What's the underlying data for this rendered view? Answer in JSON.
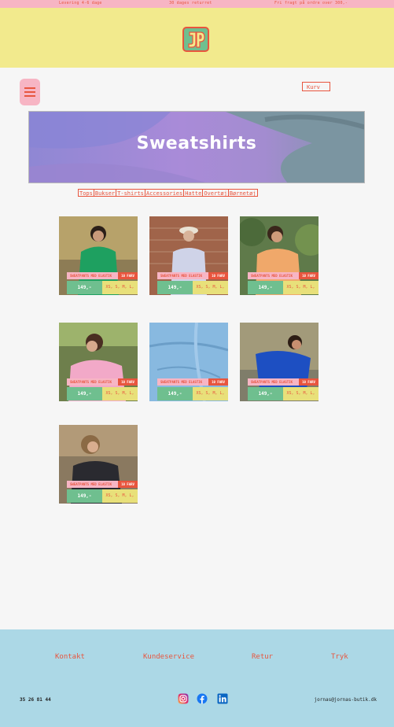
{
  "topbar": {
    "delivery": "Levering 4-6 dage",
    "returns": "30 dages returret",
    "shipping": "Fri fragt på ordre over 300,-"
  },
  "header": {
    "logo_text": "JP",
    "menu_icon": "hamburger-icon",
    "cart_label": "Kurv"
  },
  "hero": {
    "title": "Sweatshirts"
  },
  "categories": [
    "Tops",
    "Bukser",
    "T-shirts",
    "Accessories",
    "Hatte",
    "Overtøj",
    "Børnetøj"
  ],
  "products": [
    {
      "tag": "SWEATPANTS MED ELASTIK",
      "colors": "10 FARV",
      "price": "149,-",
      "sizes": "XS, S, M, L, XL"
    },
    {
      "tag": "SWEATPANTS MED ELASTIK",
      "colors": "10 FARV",
      "price": "149,-",
      "sizes": "XS, S, M, L, XL"
    },
    {
      "tag": "SWEATPANTS MED ELASTIK",
      "colors": "10 FARV",
      "price": "149,-",
      "sizes": "XS, S, M, L, XL"
    },
    {
      "tag": "SWEATPANTS MED ELASTIK",
      "colors": "10 FARV",
      "price": "149,-",
      "sizes": "XS, S, M, L, XL"
    },
    {
      "tag": "SWEATPANTS MED ELASTIK",
      "colors": "10 FARV",
      "price": "149,-",
      "sizes": "XS, S, M, L, XL"
    },
    {
      "tag": "SWEATPANTS MED ELASTIK",
      "colors": "10 FARV",
      "price": "149,-",
      "sizes": "XS, S, M, L, XL"
    },
    {
      "tag": "SWEATPANTS MED ELASTIK",
      "colors": "10 FARV",
      "price": "149,-",
      "sizes": "XS, S, M, L, XL"
    }
  ],
  "footer": {
    "links": [
      "Kontakt",
      "Kundeservice",
      "Retur",
      "Tryk"
    ],
    "phone": "35 26 81 44",
    "email": "jornas@jornas-butik.dk",
    "social_icons": [
      "instagram-icon",
      "facebook-icon",
      "linkedin-icon"
    ]
  },
  "colors": {
    "accent": "#e8553e",
    "pink": "#f7b5c4",
    "yellow": "#f2ea8d",
    "green": "#6fbf8f",
    "footer_bg": "#acd8e6"
  }
}
